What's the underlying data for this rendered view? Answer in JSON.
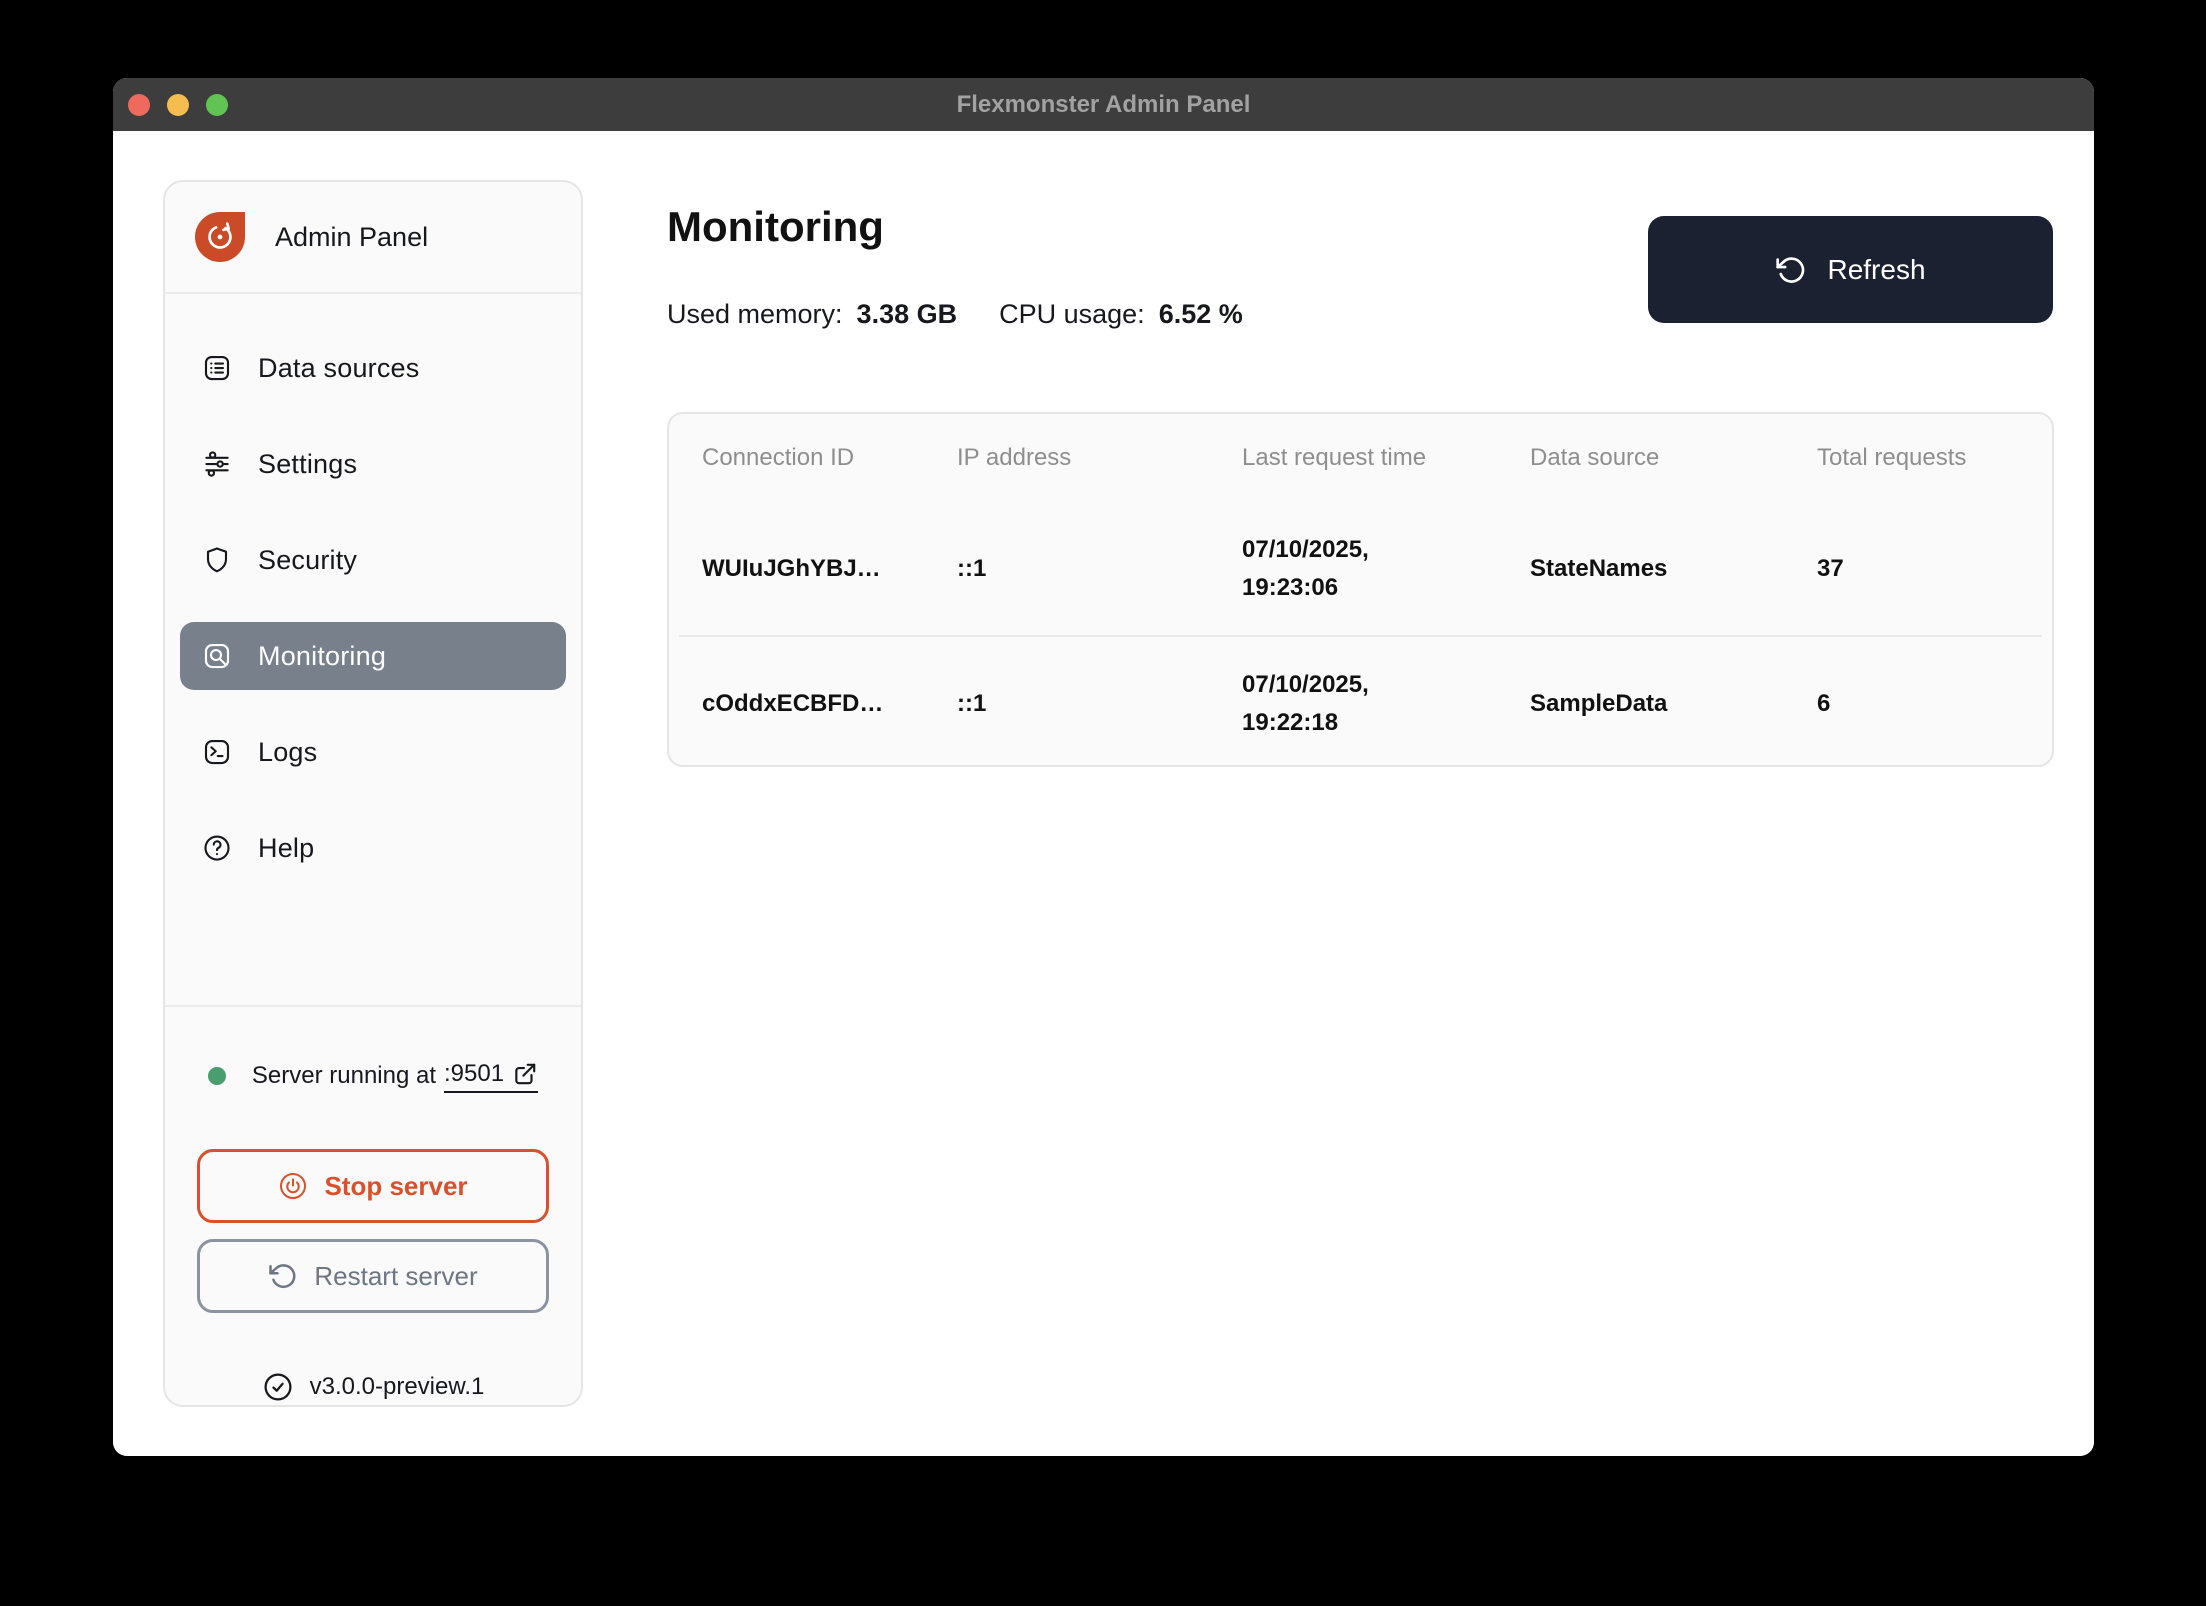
{
  "window": {
    "title": "Flexmonster Admin Panel"
  },
  "sidebar": {
    "app_name": "Admin Panel",
    "items": [
      {
        "label": "Data sources"
      },
      {
        "label": "Settings"
      },
      {
        "label": "Security"
      },
      {
        "label": "Monitoring",
        "selected": true
      },
      {
        "label": "Logs"
      },
      {
        "label": "Help"
      }
    ],
    "server_status": {
      "prefix": "Server running at",
      "port_link": ":9501"
    },
    "stop_button": "Stop server",
    "restart_button": "Restart server",
    "version": "v3.0.0-preview.1"
  },
  "main": {
    "title": "Monitoring",
    "stats": [
      {
        "label": "Used memory:",
        "value": "3.38 GB"
      },
      {
        "label": "CPU usage:",
        "value": "6.52 %"
      }
    ],
    "refresh_button": "Refresh",
    "table": {
      "columns": [
        "Connection ID",
        "IP address",
        "Last request time",
        "Data source",
        "Total requests"
      ],
      "rows": [
        {
          "connection_id": "WUIuJGhYBJ…",
          "ip": "::1",
          "last_request": "07/10/2025, 19:23:06",
          "data_source": "StateNames",
          "total_requests": "37"
        },
        {
          "connection_id": "cOddxECBFD…",
          "ip": "::1",
          "last_request": "07/10/2025, 19:22:18",
          "data_source": "SampleData",
          "total_requests": "6"
        }
      ]
    }
  },
  "colors": {
    "accent_orange": "#cb4a27",
    "stop_red": "#d8512c",
    "refresh_dark": "#1b2130",
    "selected_gray": "#77808b",
    "status_green": "#4a9d6e",
    "titlebar": "#3d3d3d",
    "card_bg": "#fafafa"
  }
}
